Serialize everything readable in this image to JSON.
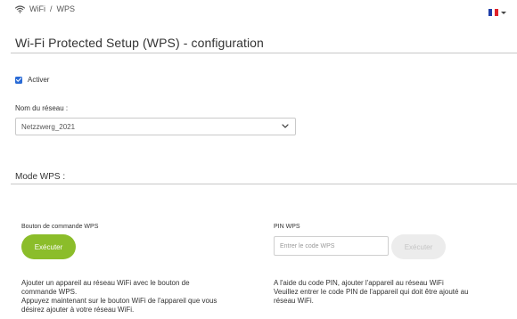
{
  "breadcrumb": {
    "wifi": "WiFi",
    "separator": "/",
    "section": "WPS"
  },
  "language": {
    "icon": "flag-france-icon",
    "colors": [
      "#1f3ea8",
      "#ffffff",
      "#e0242b"
    ]
  },
  "page_title": "Wi-Fi Protected Setup (WPS) - configuration",
  "activer": {
    "label": "Activer",
    "checked": true
  },
  "network": {
    "label": "Nom du réseau :",
    "selected": "Netzzwerg_2021"
  },
  "mode_heading": "Mode WPS :",
  "push_button": {
    "label": "Bouton de commande WPS",
    "button": "Exécuter",
    "description": [
      "Ajouter un appareil au réseau WiFi avec le bouton de",
      "commande WPS.",
      "Appuyez maintenant sur le bouton WiFi de l'appareil que vous",
      "désirez ajouter à votre réseau WiFi."
    ]
  },
  "pin": {
    "label": "PIN WPS",
    "placeholder": "Entrer le code WPS",
    "button": "Exécuter",
    "description": [
      "A l'aide du code PIN, ajouter l'appareil au réseau WiFi",
      "Veuillez entrer le code PIN de l'appareil qui doit être ajouté au",
      "réseau WiFi."
    ]
  },
  "colors": {
    "accent": "#8bbd2a",
    "checkbox": "#2a6bd6",
    "disabled": "#ececec"
  }
}
